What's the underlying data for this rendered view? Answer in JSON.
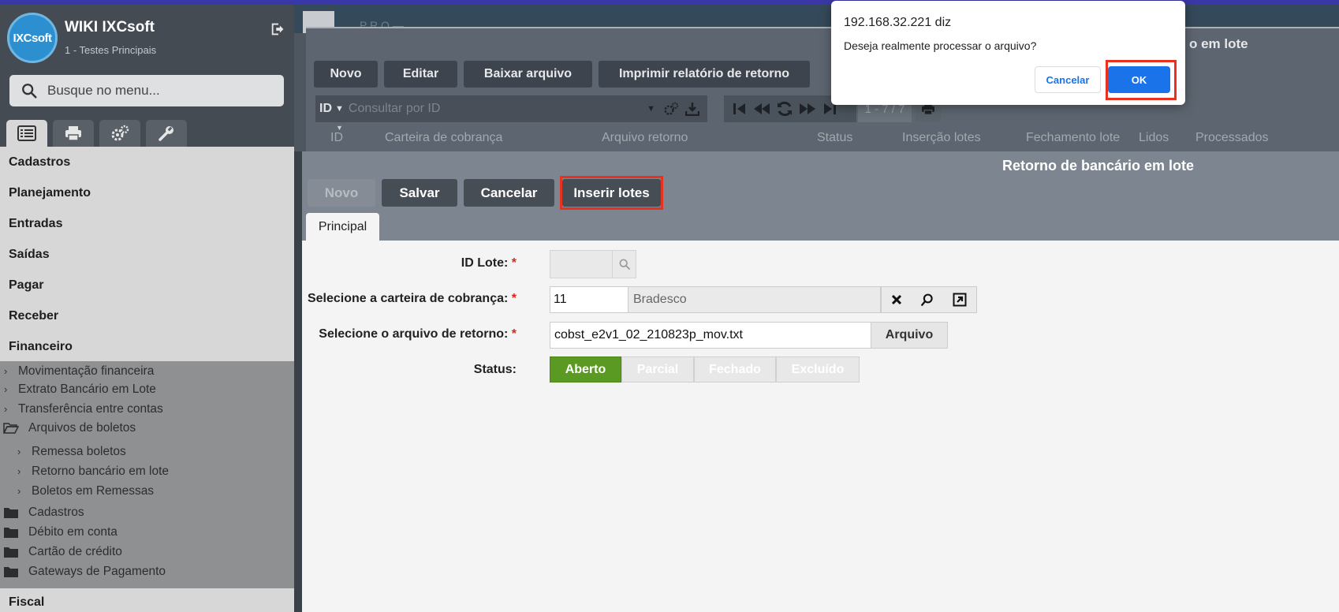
{
  "sidebar": {
    "logo_text": "IXCsoft",
    "app_title": "WIKI IXCsoft",
    "app_subtitle": "1 - Testes Principais",
    "search_placeholder": "Busque no menu...",
    "tabs": [
      {
        "icon": "list-icon"
      },
      {
        "icon": "printer-icon"
      },
      {
        "icon": "gears-icon"
      },
      {
        "icon": "wrench-icon"
      }
    ],
    "menu": [
      "Cadastros",
      "Planejamento",
      "Entradas",
      "Saídas",
      "Pagar",
      "Receber",
      "Financeiro"
    ],
    "submenu": {
      "movimentacao": "Movimentação financeira",
      "extrato": "Extrato Bancário em Lote",
      "transferencia": "Transferência entre contas",
      "arquivos_boletos": "Arquivos de boletos",
      "remessa": "Remessa boletos",
      "retorno": "Retorno bancário em lote",
      "boletos_remessas": "Boletos em Remessas",
      "cadastros": "Cadastros",
      "debito": "Débito em conta",
      "cartao": "Cartão de crédito",
      "gateways": "Gateways de Pagamento"
    },
    "fiscal": "Fiscal"
  },
  "list_window": {
    "stripe_text": "P R O —",
    "title": "o em lote",
    "buttons": {
      "novo": "Novo",
      "editar": "Editar",
      "baixar": "Baixar arquivo",
      "imprimir": "Imprimir relatório de retorno"
    },
    "search_field": "ID",
    "search_placeholder": "Consultar por ID",
    "pages": "1 - 7 / 7",
    "columns": [
      "ID",
      "Carteira de cobrança",
      "Arquivo retorno",
      "Status",
      "Inserção lotes",
      "Fechamento lote",
      "Lidos",
      "Processados"
    ]
  },
  "form": {
    "title": "Retorno de bancário em lote",
    "buttons": {
      "novo": "Novo",
      "salvar": "Salvar",
      "cancelar": "Cancelar",
      "inserir": "Inserir lotes"
    },
    "tab": "Principal",
    "labels": {
      "id_lote": "ID Lote:",
      "carteira": "Selecione a carteira de cobrança:",
      "arquivo": "Selecione o arquivo de retorno:",
      "status": "Status:"
    },
    "required_mark": "*",
    "id_lote_value": "",
    "carteira_code": "11",
    "carteira_name": "Bradesco",
    "arquivo_value": "cobst_e2v1_02_210823p_mov.txt",
    "arquivo_button": "Arquivo",
    "status_options": [
      "Aberto",
      "Parcial",
      "Fechado",
      "Excluído"
    ],
    "status_selected": "Aberto"
  },
  "dialog": {
    "title": "192.168.32.221 diz",
    "message": "Deseja realmente processar o arquivo?",
    "cancel": "Cancelar",
    "ok": "OK"
  },
  "colors": {
    "accent": "#1a73e8",
    "highlight": "#e8321f",
    "status_active": "#5b9a22",
    "sidebar_dark": "#454b52"
  }
}
